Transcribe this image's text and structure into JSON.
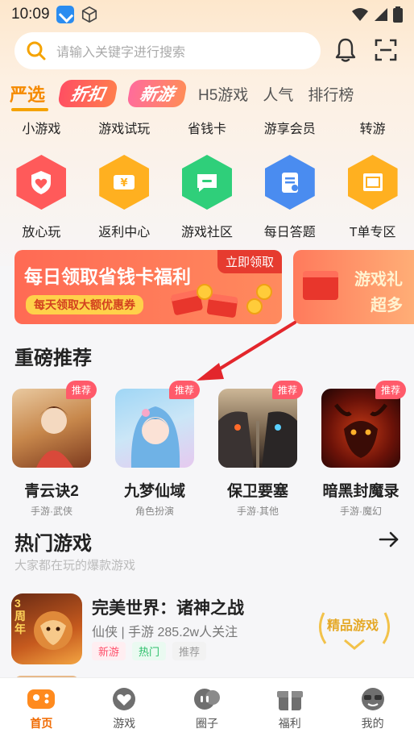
{
  "status_bar": {
    "time": "10:09"
  },
  "search": {
    "placeholder": "请输入关键字进行搜索"
  },
  "tabs": [
    {
      "label": "严选",
      "active": true
    },
    {
      "label": "折扣",
      "style": "badge"
    },
    {
      "label": "新游",
      "style": "badge"
    },
    {
      "label": "H5游戏"
    },
    {
      "label": "人气"
    },
    {
      "label": "排行榜"
    }
  ],
  "quick_links": [
    "小游戏",
    "游戏试玩",
    "省钱卡",
    "游享会员",
    "转游"
  ],
  "icon_grid": [
    {
      "label": "放心玩",
      "icon": "shield-heart-icon",
      "color": "#ff5a5a"
    },
    {
      "label": "返利中心",
      "icon": "yen-ticket-icon",
      "color": "#ffb020"
    },
    {
      "label": "游戏社区",
      "icon": "chat-bubble-icon",
      "color": "#2fcf7a"
    },
    {
      "label": "每日答题",
      "icon": "clipboard-icon",
      "color": "#4a8cf0"
    },
    {
      "label": "T单专区",
      "icon": "zhao-ticket-icon",
      "color": "#ffb020"
    }
  ],
  "banners": {
    "main": {
      "title": "每日领取省钱卡福利",
      "subtitle": "每天领取大额优惠券",
      "tag": "立即领取"
    },
    "side": {
      "title": "游戏礼",
      "subtitle": "超多"
    }
  },
  "featured": {
    "title": "重磅推荐",
    "badge": "推荐",
    "games": [
      {
        "name": "青云诀2",
        "genre": "手游·武侠",
        "colors": [
          "#c8a06a",
          "#f3d7b0"
        ]
      },
      {
        "name": "九梦仙域",
        "genre": "角色扮演",
        "colors": [
          "#7fc3ee",
          "#e7c5f1"
        ]
      },
      {
        "name": "保卫要塞",
        "genre": "手游·其他",
        "colors": [
          "#3a3030",
          "#b8925c"
        ]
      },
      {
        "name": "暗黑封魔录",
        "genre": "手游·魔幻",
        "colors": [
          "#3a0b0b",
          "#d24a1d"
        ]
      }
    ]
  },
  "hot": {
    "title": "热门游戏",
    "subtitle": "大家都在玩的爆款游戏",
    "item": {
      "name": "完美世界：诸神之战",
      "meta": "仙侠 | 手游  285.2w人关注",
      "thumb_text": "3周年",
      "tags": [
        {
          "label": "新游",
          "color": "#ff4f6a",
          "bg": "#ffeef1"
        },
        {
          "label": "热门",
          "color": "#2cbf6a",
          "bg": "#eafaf1"
        },
        {
          "label": "推荐",
          "color": "#999999",
          "bg": "#f2f2f2"
        }
      ],
      "badge": "精品游戏"
    }
  },
  "bottom_nav": [
    {
      "label": "首页",
      "active": true
    },
    {
      "label": "游戏"
    },
    {
      "label": "圈子"
    },
    {
      "label": "福利"
    },
    {
      "label": "我的"
    }
  ],
  "colors": {
    "accent": "#f58a00",
    "active_nav": "#f06a00"
  }
}
